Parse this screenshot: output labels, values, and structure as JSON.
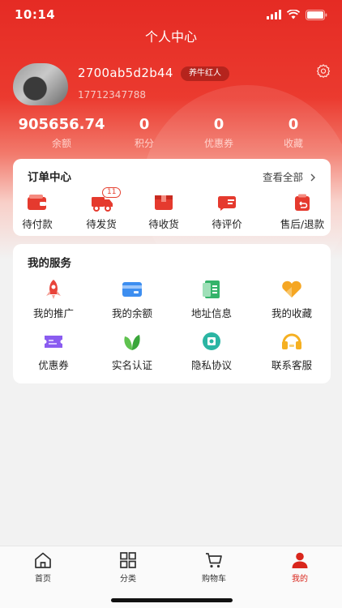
{
  "status_bar": {
    "time": "10:14"
  },
  "header": {
    "title": "个人中心"
  },
  "profile": {
    "username": "2700ab5d2b44",
    "badge": "养牛红人",
    "phone": "17712347788"
  },
  "stats": [
    {
      "value": "905656.74",
      "label": "余额"
    },
    {
      "value": "0",
      "label": "积分"
    },
    {
      "value": "0",
      "label": "优惠券"
    },
    {
      "value": "0",
      "label": "收藏"
    }
  ],
  "orders": {
    "title": "订单中心",
    "view_all": "查看全部",
    "items": [
      {
        "label": "待付款",
        "icon": "wallet-icon"
      },
      {
        "label": "待发货",
        "icon": "truck-icon",
        "badge": "11"
      },
      {
        "label": "待收货",
        "icon": "box-icon"
      },
      {
        "label": "待评价",
        "icon": "review-icon"
      },
      {
        "label": "售后/退款",
        "icon": "refund-icon"
      }
    ]
  },
  "services": {
    "title": "我的服务",
    "items": [
      {
        "label": "我的推广",
        "icon": "rocket-icon"
      },
      {
        "label": "我的余额",
        "icon": "card-icon"
      },
      {
        "label": "地址信息",
        "icon": "address-book-icon"
      },
      {
        "label": "我的收藏",
        "icon": "heart-icon"
      },
      {
        "label": "优惠券",
        "icon": "coupon-icon"
      },
      {
        "label": "实名认证",
        "icon": "leaf-icon"
      },
      {
        "label": "隐私协议",
        "icon": "privacy-icon"
      },
      {
        "label": "联系客服",
        "icon": "headset-icon"
      }
    ]
  },
  "tabbar": [
    {
      "label": "首页",
      "icon": "home-icon"
    },
    {
      "label": "分类",
      "icon": "grid-icon"
    },
    {
      "label": "购物车",
      "icon": "cart-icon"
    },
    {
      "label": "我的",
      "icon": "user-icon",
      "active": true
    }
  ],
  "colors": {
    "brand_red": "#e52b24",
    "active_tab": "#d9261c"
  }
}
